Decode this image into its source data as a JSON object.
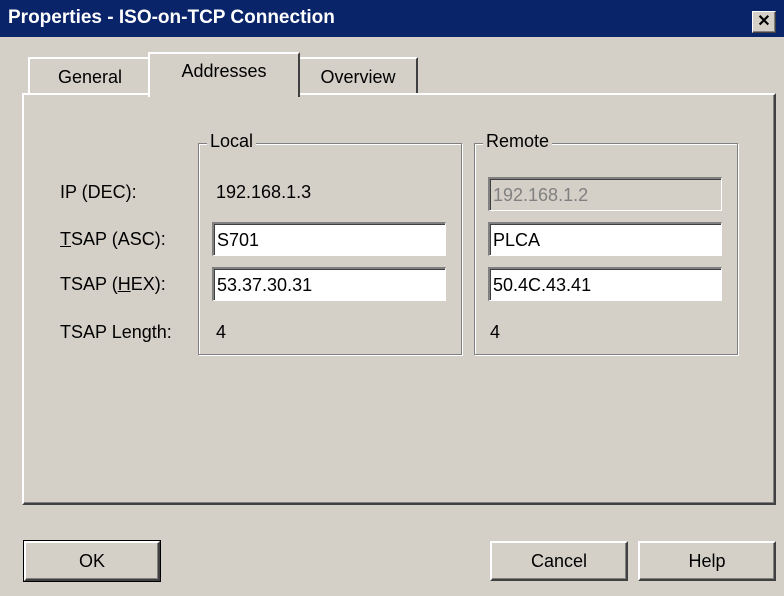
{
  "window": {
    "title": "Properties - ISO-on-TCP Connection",
    "close_glyph": "✕"
  },
  "tabs": [
    {
      "label": "General",
      "active": false
    },
    {
      "label": "Addresses",
      "active": true
    },
    {
      "label": "Overview",
      "active": false
    }
  ],
  "local": {
    "legend": "Local",
    "ip": "192.168.1.3",
    "tsap_asc": "S701",
    "tsap_hex": "53.37.30.31",
    "tsap_length": "4"
  },
  "remote": {
    "legend": "Remote",
    "ip": "192.168.1.2",
    "tsap_asc": "PLCA",
    "tsap_hex": "50.4C.43.41",
    "tsap_length": "4"
  },
  "labels": {
    "ip": "IP (DEC):",
    "tsap_asc_mnemonic": "T",
    "tsap_asc_rest": "SAP (ASC):",
    "tsap_hex_prefix": "TSAP (",
    "tsap_hex_mnemonic": "H",
    "tsap_hex_suffix": "EX):",
    "tsap_length": "TSAP Length:"
  },
  "buttons": {
    "ok": "OK",
    "cancel": "Cancel",
    "help": "Help"
  }
}
